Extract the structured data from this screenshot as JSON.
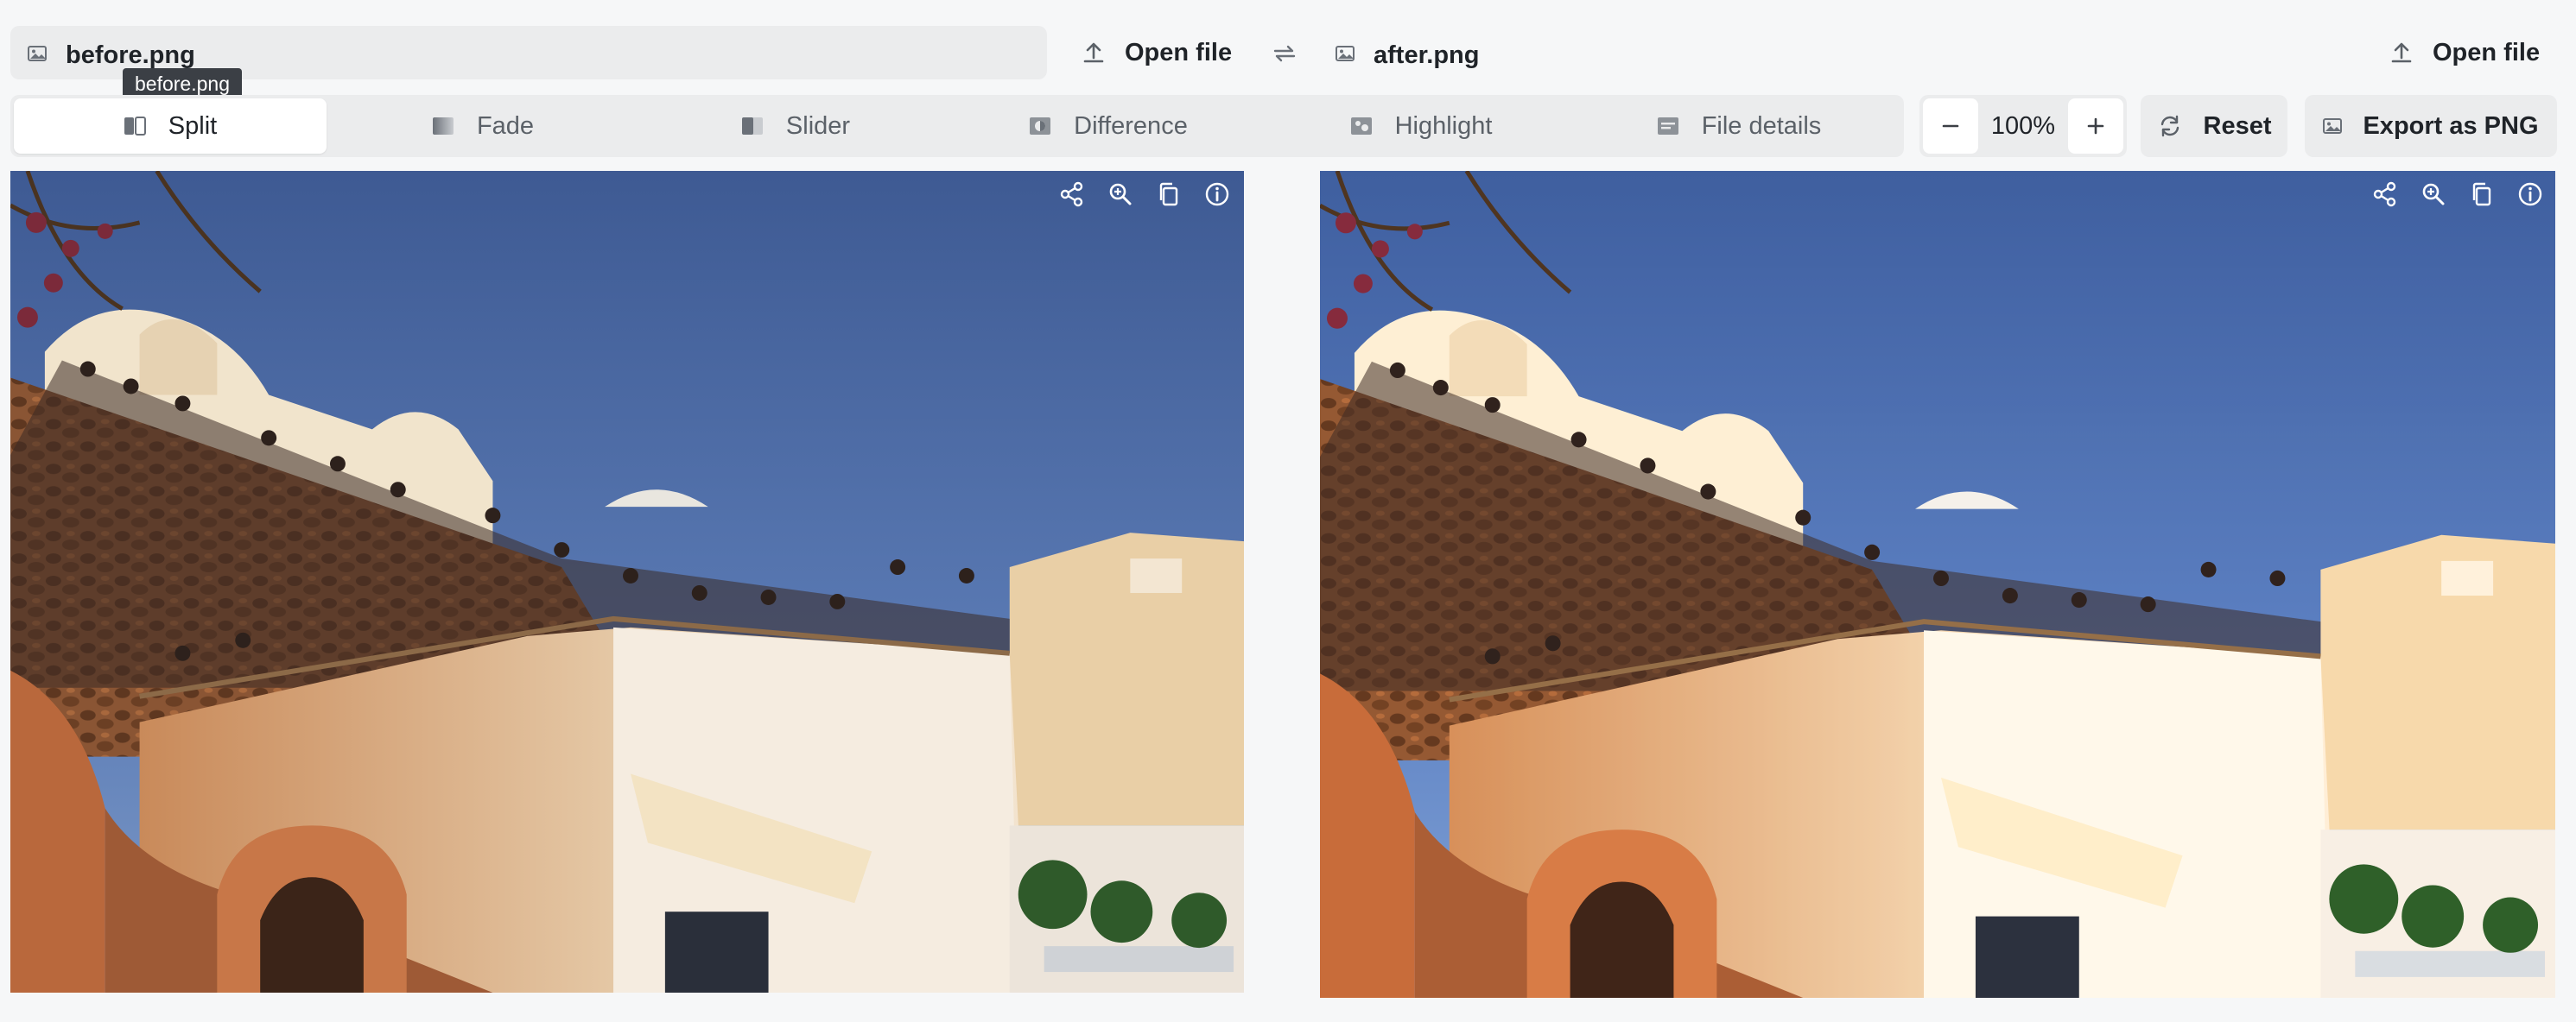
{
  "before": {
    "file_name": "before.png",
    "tooltip": "before.png",
    "open_label": "Open file",
    "file_icon": "image-icon"
  },
  "after": {
    "file_name": "after.png",
    "open_label": "Open file",
    "file_icon": "image-icon"
  },
  "swap_icon": "swap-arrows-icon",
  "tabs": [
    {
      "label": "Split",
      "icon": "split-icon",
      "active": true
    },
    {
      "label": "Fade",
      "icon": "fade-icon",
      "active": false
    },
    {
      "label": "Slider",
      "icon": "slider-icon",
      "active": false
    },
    {
      "label": "Difference",
      "icon": "difference-icon",
      "active": false
    },
    {
      "label": "Highlight",
      "icon": "highlight-icon",
      "active": false
    },
    {
      "label": "File details",
      "icon": "file-details-icon",
      "active": false
    }
  ],
  "zoom": {
    "value": "100%",
    "minus_icon": "minus-icon",
    "plus_icon": "plus-icon"
  },
  "reset_label": "Reset",
  "export_label": "Export as PNG",
  "image_toolbar_icons": [
    "share-icon",
    "zoom-icon",
    "copy-icon",
    "info-icon"
  ],
  "colors": {
    "background": "#f6f7f8",
    "control_bg": "#ebeced",
    "active_tab": "#ffffff",
    "text": "#1f2328",
    "muted_text": "#5b6168",
    "tooltip_bg": "#3b3f45"
  }
}
